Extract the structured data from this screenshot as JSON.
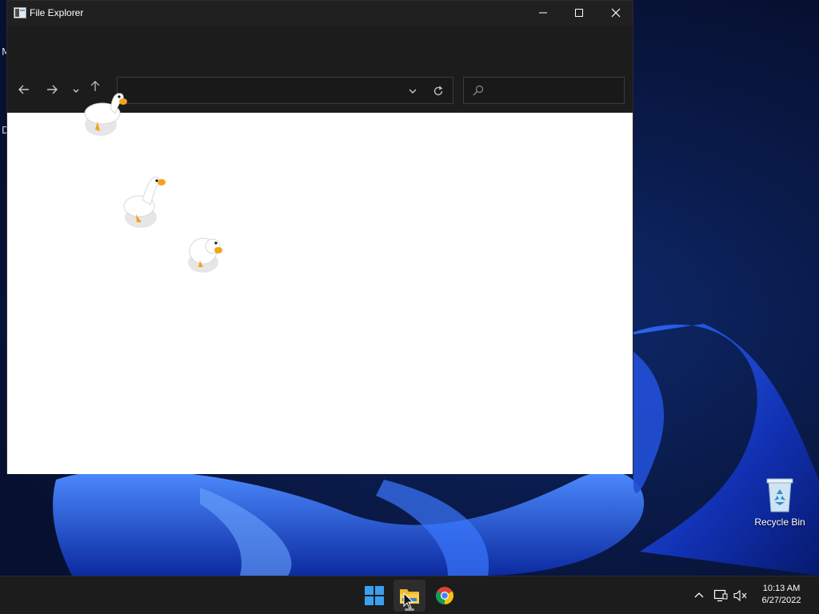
{
  "window": {
    "title": "File Explorer",
    "address_value": "",
    "search_placeholder": ""
  },
  "desktop": {
    "side_glyph_1": "M",
    "side_glyph_2": "D",
    "recycle_bin_label": "Recycle Bin"
  },
  "taskbar": {
    "apps": [
      "start",
      "file-explorer",
      "chrome"
    ],
    "active_app": "file-explorer",
    "time": "10:13 AM",
    "date": "6/27/2022"
  },
  "icons": {
    "window": [
      "app-icon",
      "minimize-icon",
      "maximize-icon",
      "close-icon"
    ],
    "nav": [
      "back-arrow-icon",
      "forward-arrow-icon",
      "chevron-down-icon",
      "up-arrow-icon",
      "refresh-icon",
      "search-icon"
    ],
    "tray": [
      "chevron-up-icon",
      "network-icon",
      "volume-muted-icon"
    ]
  },
  "colors": {
    "titlebar": "#202020",
    "navbar": "#1c1c1c",
    "taskbar": "#1c1c1c",
    "wallpaper_accent": "#1e5bff",
    "goose_beak": "#f4a21b"
  }
}
